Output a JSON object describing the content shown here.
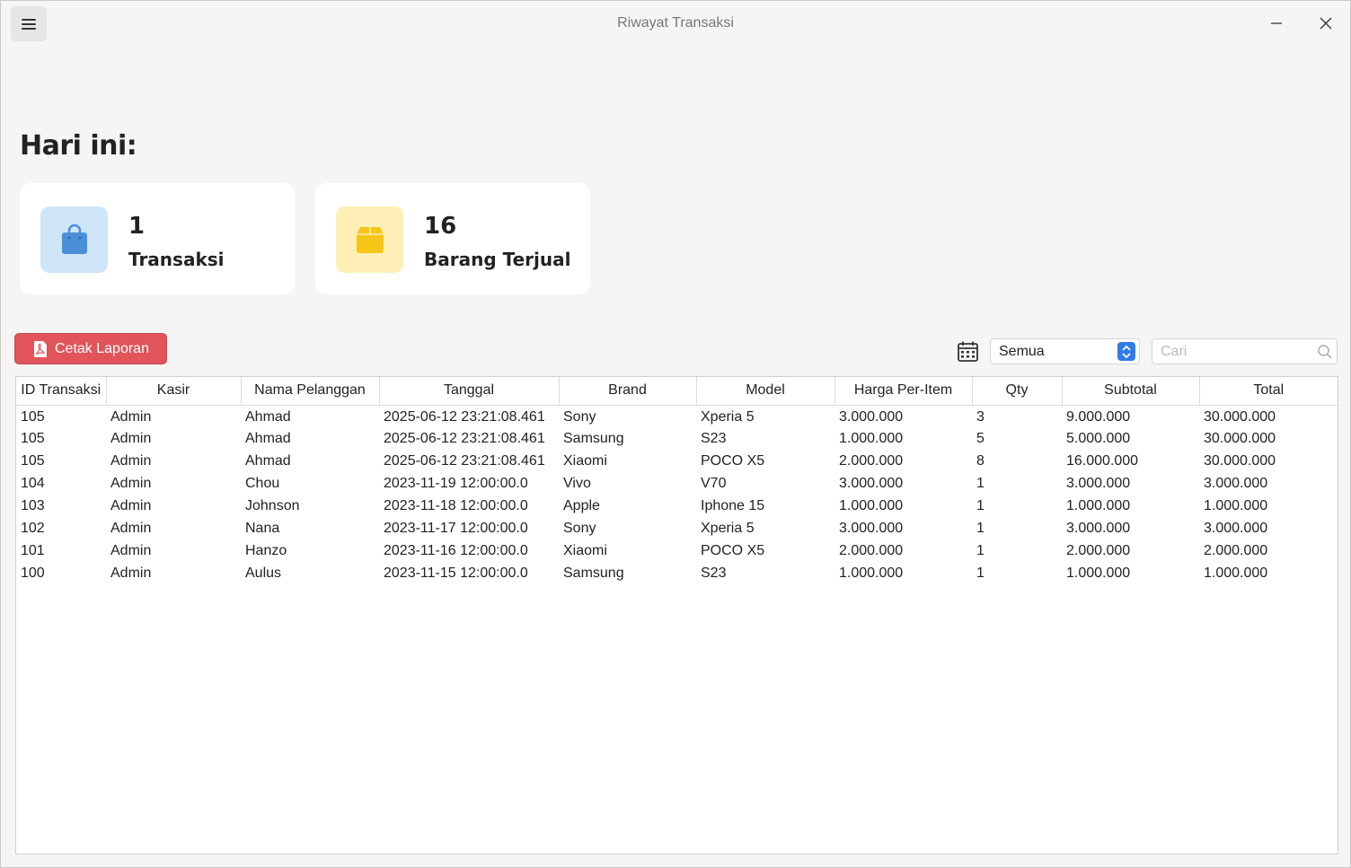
{
  "window": {
    "title": "Riwayat Transaksi"
  },
  "heading": "Hari ini:",
  "cards": [
    {
      "value": "1",
      "label": "Transaksi",
      "icon": "shopping-bag-icon",
      "accent": "#4a90d9"
    },
    {
      "value": "16",
      "label": "Barang Terjual",
      "icon": "box-icon",
      "accent": "#f5c518"
    }
  ],
  "toolbar": {
    "print_label": "Cetak Laporan",
    "filter_value": "Semua",
    "search_placeholder": "Cari",
    "print_color": "#e0545a",
    "select_accent": "#2f7be8"
  },
  "table": {
    "columns": [
      "ID Transaksi",
      "Kasir",
      "Nama Pelanggan",
      "Tanggal",
      "Brand",
      "Model",
      "Harga Per-Item",
      "Qty",
      "Subtotal",
      "Total"
    ],
    "rows": [
      [
        "105",
        "Admin",
        "Ahmad",
        "2025-06-12 23:21:08.461",
        "Sony",
        "Xperia 5",
        "3.000.000",
        "3",
        "9.000.000",
        "30.000.000"
      ],
      [
        "105",
        "Admin",
        "Ahmad",
        "2025-06-12 23:21:08.461",
        "Samsung",
        "S23",
        "1.000.000",
        "5",
        "5.000.000",
        "30.000.000"
      ],
      [
        "105",
        "Admin",
        "Ahmad",
        "2025-06-12 23:21:08.461",
        "Xiaomi",
        "POCO X5",
        "2.000.000",
        "8",
        "16.000.000",
        "30.000.000"
      ],
      [
        "104",
        "Admin",
        "Chou",
        "2023-11-19 12:00:00.0",
        "Vivo",
        "V70",
        "3.000.000",
        "1",
        "3.000.000",
        "3.000.000"
      ],
      [
        "103",
        "Admin",
        "Johnson",
        "2023-11-18 12:00:00.0",
        "Apple",
        "Iphone 15",
        "1.000.000",
        "1",
        "1.000.000",
        "1.000.000"
      ],
      [
        "102",
        "Admin",
        "Nana",
        "2023-11-17 12:00:00.0",
        "Sony",
        "Xperia 5",
        "3.000.000",
        "1",
        "3.000.000",
        "3.000.000"
      ],
      [
        "101",
        "Admin",
        "Hanzo",
        "2023-11-16 12:00:00.0",
        "Xiaomi",
        "POCO X5",
        "2.000.000",
        "1",
        "2.000.000",
        "2.000.000"
      ],
      [
        "100",
        "Admin",
        "Aulus",
        "2023-11-15 12:00:00.0",
        "Samsung",
        "S23",
        "1.000.000",
        "1",
        "1.000.000",
        "1.000.000"
      ]
    ]
  }
}
